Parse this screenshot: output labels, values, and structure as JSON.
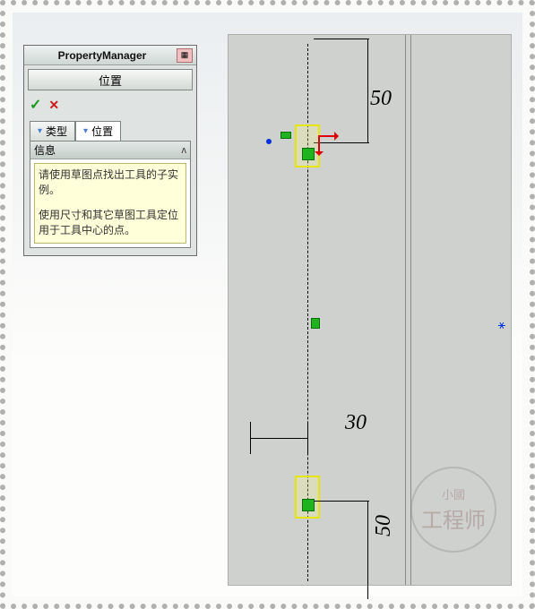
{
  "pm": {
    "title": "PropertyManager",
    "pin_icon": "pin-icon",
    "command_label": "位置",
    "ok_icon": "✓",
    "cancel_icon": "✕",
    "tabs": [
      {
        "label": "类型",
        "active": false
      },
      {
        "label": "位置",
        "active": true
      }
    ],
    "info_section": {
      "header": "信息",
      "collapse_glyph": "«",
      "paragraphs": [
        "请使用草图点找出工具的子实例。",
        "使用尺寸和其它草图工具定位用于工具中心的点。"
      ]
    }
  },
  "viewport": {
    "dimensions": {
      "top_vertical": "50",
      "mid_horizontal": "30",
      "bottom_vertical": "50"
    },
    "sketch_points": [
      {
        "name": "library-feature-instance-top"
      },
      {
        "name": "library-feature-instance-bottom"
      }
    ]
  },
  "watermark": {
    "small": "小國",
    "big": "工程师"
  }
}
